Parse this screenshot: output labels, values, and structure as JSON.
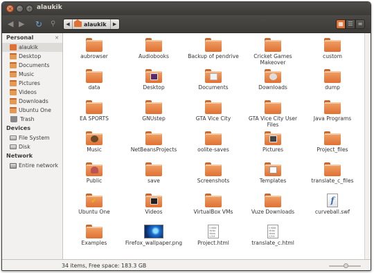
{
  "window": {
    "title": "alaukik"
  },
  "toolbar": {
    "path_segment": "alaukik"
  },
  "sidebar": {
    "personal_header": "Personal",
    "personal": [
      {
        "label": "alaukik",
        "icon": "home-folder-icon"
      },
      {
        "label": "Desktop",
        "icon": "folder-icon"
      },
      {
        "label": "Documents",
        "icon": "folder-icon"
      },
      {
        "label": "Music",
        "icon": "folder-icon"
      },
      {
        "label": "Pictures",
        "icon": "folder-icon"
      },
      {
        "label": "Videos",
        "icon": "folder-icon"
      },
      {
        "label": "Downloads",
        "icon": "folder-icon"
      },
      {
        "label": "Ubuntu One",
        "icon": "folder-icon"
      },
      {
        "label": "Trash",
        "icon": "trash-icon"
      }
    ],
    "devices_header": "Devices",
    "devices": [
      {
        "label": "File System",
        "icon": "drive-icon"
      },
      {
        "label": "Disk",
        "icon": "drive-icon"
      }
    ],
    "network_header": "Network",
    "network": [
      {
        "label": "Entire network",
        "icon": "network-icon"
      }
    ]
  },
  "files": [
    {
      "name": "aubrowser",
      "type": "folder"
    },
    {
      "name": "Audiobooks",
      "type": "folder"
    },
    {
      "name": "Backup of pendrive",
      "type": "folder"
    },
    {
      "name": "Cricket Games Makeover",
      "type": "folder"
    },
    {
      "name": "custom",
      "type": "folder"
    },
    {
      "name": "data",
      "type": "folder"
    },
    {
      "name": "Desktop",
      "type": "folder",
      "emblem": "desktop"
    },
    {
      "name": "Documents",
      "type": "folder",
      "emblem": "docs"
    },
    {
      "name": "Downloads",
      "type": "folder",
      "emblem": "down"
    },
    {
      "name": "dump",
      "type": "folder"
    },
    {
      "name": "EA SPORTS",
      "type": "folder"
    },
    {
      "name": "GNUstep",
      "type": "folder"
    },
    {
      "name": "GTA Vice City",
      "type": "folder"
    },
    {
      "name": "GTA Vice City User Files",
      "type": "folder"
    },
    {
      "name": "Java Programs",
      "type": "folder"
    },
    {
      "name": "Music",
      "type": "folder",
      "emblem": "music"
    },
    {
      "name": "NetBeansProjects",
      "type": "folder"
    },
    {
      "name": "oolite-saves",
      "type": "folder"
    },
    {
      "name": "Pictures",
      "type": "folder",
      "emblem": "pics"
    },
    {
      "name": "Project_files",
      "type": "folder"
    },
    {
      "name": "Public",
      "type": "folder",
      "emblem": "public"
    },
    {
      "name": "save",
      "type": "folder"
    },
    {
      "name": "Screenshots",
      "type": "folder"
    },
    {
      "name": "Templates",
      "type": "folder",
      "emblem": "templates"
    },
    {
      "name": "translate_c_files",
      "type": "folder"
    },
    {
      "name": "Ubuntu One",
      "type": "folder",
      "emblem": "ubuntu"
    },
    {
      "name": "Videos",
      "type": "folder",
      "emblem": "videos"
    },
    {
      "name": "VirtualBox VMs",
      "type": "folder"
    },
    {
      "name": "Vuze Downloads",
      "type": "folder"
    },
    {
      "name": "curveball.swf",
      "type": "swf"
    },
    {
      "name": "Examples",
      "type": "folder"
    },
    {
      "name": "Firefox_wallpaper.png",
      "type": "image"
    },
    {
      "name": "Project.html",
      "type": "html"
    },
    {
      "name": "translate_c.html",
      "type": "html"
    }
  ],
  "status": {
    "text": "34 items, Free space: 183.3 GB"
  },
  "colors": {
    "accent": "#e07033",
    "titlebar": "#3c3b37"
  }
}
